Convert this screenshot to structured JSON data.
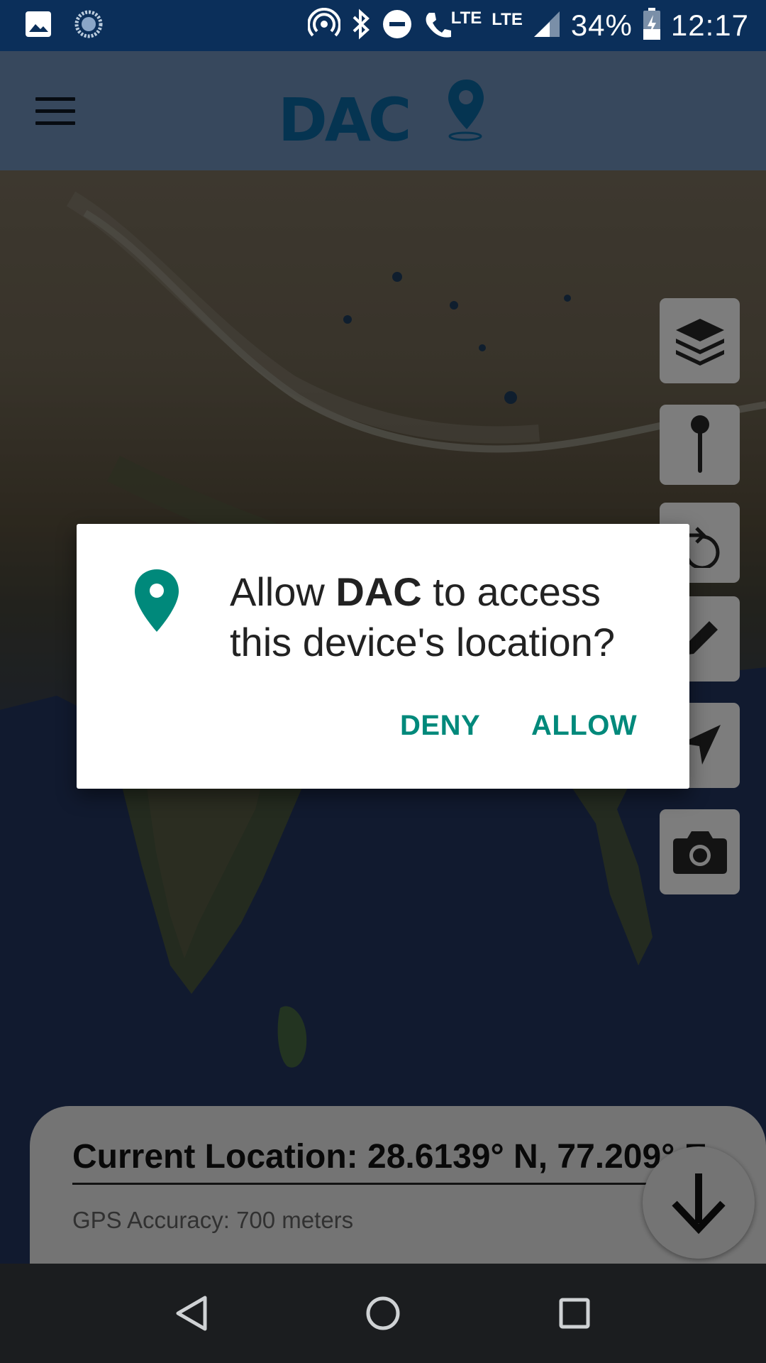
{
  "status_bar": {
    "battery": "34%",
    "time": "12:17",
    "lte1": "LTE",
    "lte2": "LTE"
  },
  "app_bar": {
    "logo_text": "DAC"
  },
  "dialog": {
    "title_prefix": "Allow ",
    "app_name": "DAC",
    "title_suffix": " to access this device's location?",
    "deny_label": "DENY",
    "allow_label": "ALLOW",
    "accent_color": "#00897b"
  },
  "map_tools": [
    "layers-icon",
    "pin-icon",
    "redo-icon",
    "pencil-icon",
    "navigation-icon",
    "camera-icon"
  ],
  "location_panel": {
    "current_location": "Current Location: 28.6139° N, 77.209° E",
    "gps_accuracy": "GPS Accuracy: 700 meters"
  },
  "colors": {
    "status_bar": "#0b2f5a",
    "app_bar": "#5f7ca0",
    "logo": "#0a5a8c",
    "dialog_button": "#00897b"
  }
}
